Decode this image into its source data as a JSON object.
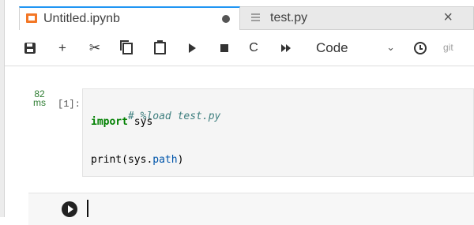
{
  "tabs": [
    {
      "label": "Untitled.ipynb",
      "active": true,
      "dirty": true
    },
    {
      "label": "test.py",
      "active": false
    }
  ],
  "toolbar": {
    "cell_type": "Code",
    "git_label": "git"
  },
  "cell": {
    "exec_time_value": "82",
    "exec_time_unit": "ms",
    "prompt": "[1]:",
    "code": {
      "line1_comment": "# %load test.py",
      "line2_keyword": "import",
      "line2_rest": " sys",
      "line4_func": "print(sys.",
      "line4_attr": "path",
      "line4_close": ")"
    }
  },
  "colors": {
    "tab_accent": "#2196f3",
    "notebook_icon": "#f37726",
    "exec_time": "#2e7d32"
  }
}
